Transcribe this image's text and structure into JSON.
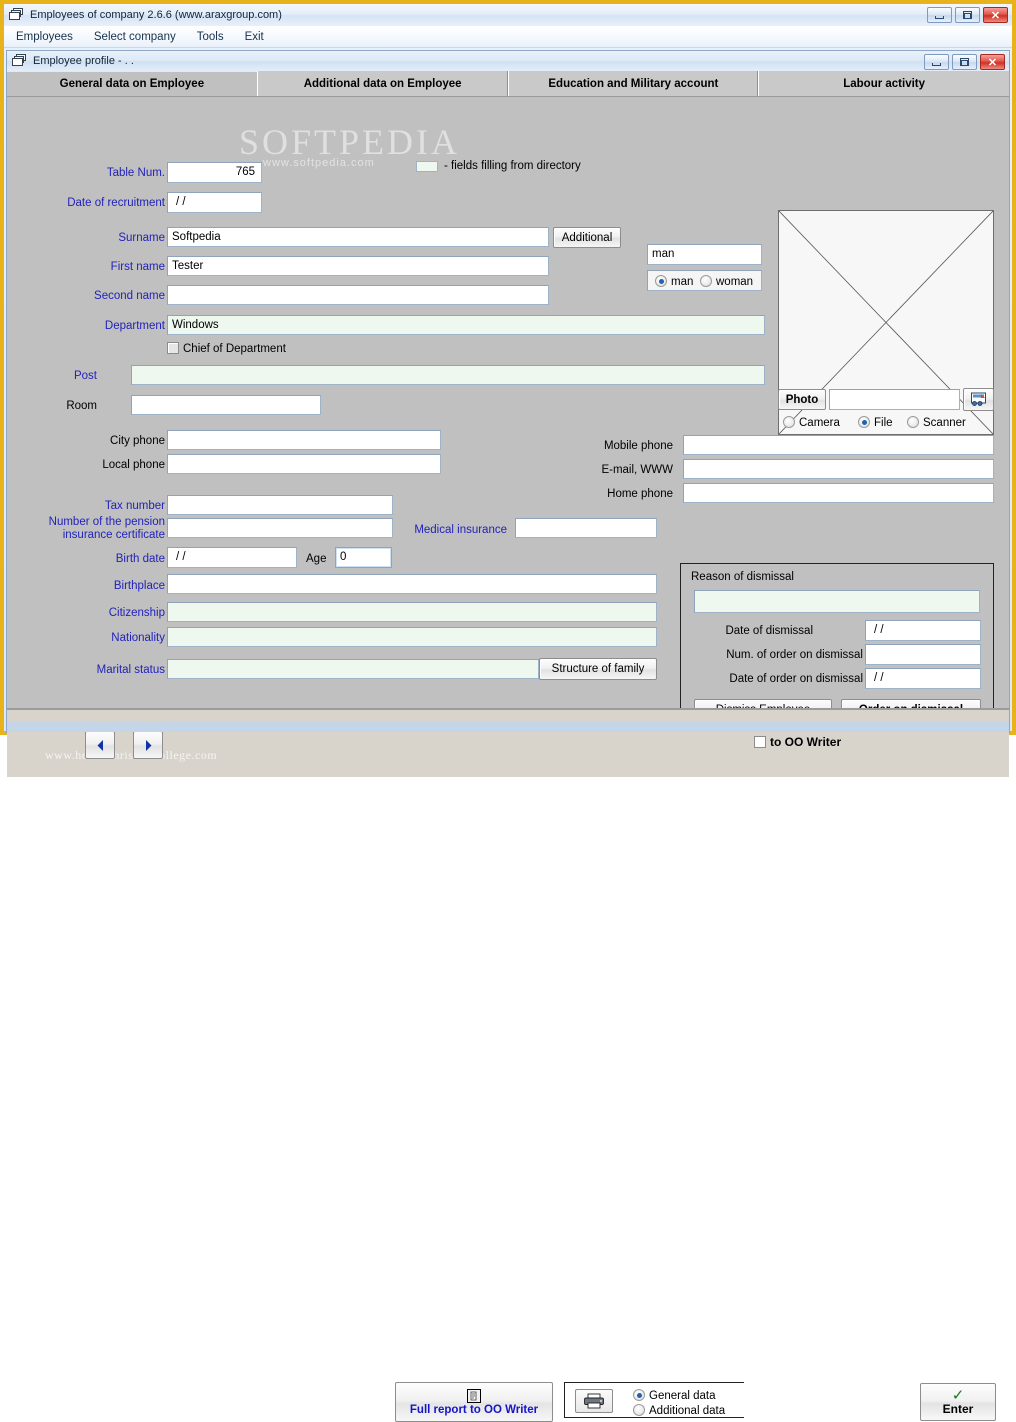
{
  "window": {
    "title": "Employees of company 2.6.6 (www.araxgroup.com)",
    "icon": "application-stack-icon",
    "controls": {
      "minimize": "—",
      "maximize": "□",
      "close": "✕"
    }
  },
  "menu": {
    "items": [
      {
        "label": "Employees"
      },
      {
        "label": "Select company"
      },
      {
        "label": "Tools"
      },
      {
        "label": "Exit"
      }
    ]
  },
  "child_window": {
    "title": "Employee profile -  . ."
  },
  "tabs": [
    {
      "label": "General data on Employee",
      "active": true
    },
    {
      "label": "Additional data on Employee",
      "active": false
    },
    {
      "label": "Education and Military account",
      "active": false
    },
    {
      "label": "Labour activity",
      "active": false
    }
  ],
  "legend": {
    "text": "- fields filling from directory",
    "swatch_color": "#eef8ee"
  },
  "watermarks": {
    "big": "SOFTPEDIA",
    "small": "www.softpedia.com",
    "bottom": "www.healthchristiancollege.com"
  },
  "form": {
    "table_num": {
      "label": "Table Num.",
      "value": "765"
    },
    "date_of_recruitment": {
      "label": "Date of recruitment",
      "value": "/ /"
    },
    "surname": {
      "label": "Surname",
      "value": "Softpedia"
    },
    "first_name": {
      "label": "First name",
      "value": "Tester"
    },
    "second_name": {
      "label": "Second name",
      "value": ""
    },
    "department": {
      "label": "Department",
      "value": "Windows"
    },
    "chief_of_department": {
      "label": "Chief of Department",
      "checked": false
    },
    "post": {
      "label": "Post",
      "value": ""
    },
    "room": {
      "label": "Room",
      "value": ""
    },
    "city_phone": {
      "label": "City phone",
      "value": ""
    },
    "local_phone": {
      "label": "Local phone",
      "value": ""
    },
    "tax_number": {
      "label": "Tax number",
      "value": ""
    },
    "pension_certificate": {
      "label": "Number of the pension insurance certificate",
      "value": ""
    },
    "medical_insurance": {
      "label": "Medical insurance",
      "value": ""
    },
    "birth_date": {
      "label": "Birth date",
      "value": "/ /"
    },
    "age": {
      "label": "Age",
      "value": "0"
    },
    "birthplace": {
      "label": "Birthplace",
      "value": ""
    },
    "citizenship": {
      "label": "Citizenship",
      "value": ""
    },
    "nationality": {
      "label": "Nationality",
      "value": ""
    },
    "marital_status": {
      "label": "Marital status",
      "value": ""
    },
    "structure_of_family_button": "Structure of family",
    "additional_button": "Additional",
    "mobile_phone": {
      "label": "Mobile phone",
      "value": ""
    },
    "email_www": {
      "label": "E-mail, WWW",
      "value": ""
    },
    "home_phone": {
      "label": "Home phone",
      "value": ""
    }
  },
  "gender": {
    "value": "man",
    "options": [
      {
        "label": "man",
        "selected": true
      },
      {
        "label": "woman",
        "selected": false
      }
    ]
  },
  "photo": {
    "button_label": "Photo",
    "path_value": "",
    "browse_icon": "image-browse-icon",
    "sources": [
      {
        "label": "Camera",
        "selected": false
      },
      {
        "label": "File",
        "selected": true
      },
      {
        "label": "Scanner",
        "selected": false
      }
    ]
  },
  "dismissal": {
    "group_title": "Reason of dismissal",
    "reason_value": "",
    "date_of_dismissal": {
      "label": "Date of dismissal",
      "value": "/ /"
    },
    "num_of_order": {
      "label": "Num. of order on dismissal",
      "value": ""
    },
    "date_of_order": {
      "label": "Date of order on dismissal",
      "value": "/ /"
    },
    "dismiss_button": "Dismiss Employee",
    "order_button": "Order on dismissal"
  },
  "bottom": {
    "prev_icon": "arrow-left-icon",
    "next_icon": "arrow-right-icon",
    "report_button": {
      "label": "Full report to OO Writer",
      "icon": "document-writer-icon"
    },
    "print_icon": "printer-icon",
    "print_options": [
      {
        "label": "General data",
        "selected": true
      },
      {
        "label": "Additional data",
        "selected": false
      }
    ],
    "to_oo_writer": {
      "label": "to OO Writer",
      "checked": false
    },
    "enter_button": {
      "label": "Enter",
      "icon": "check-icon"
    }
  },
  "colors": {
    "label_blue": "#2222bb",
    "directory_field": "#eef8ee",
    "window_border": "#e8b21a",
    "form_background": "#c0c0c0"
  }
}
